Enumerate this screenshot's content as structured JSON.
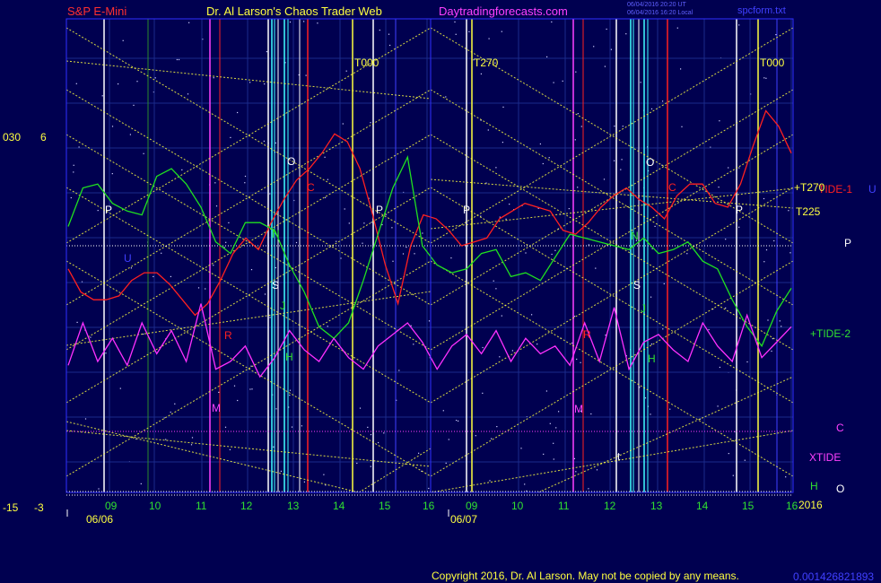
{
  "header": {
    "instrument": "S&P E-Mini",
    "author": "Dr. Al Larson's Chaos Trader Web",
    "site": "Daytradingforecasts.com",
    "stamp1": "06/04/2016 20:20 UT",
    "stamp2": "06/04/2016 16:20 Local",
    "file": "spcform.txt"
  },
  "left_axis": {
    "top": [
      "030",
      "6"
    ],
    "bottom": [
      "-15",
      "-3"
    ]
  },
  "dates": [
    "06/06",
    "06/07"
  ],
  "hour_labels": [
    "09",
    "10",
    "11",
    "12",
    "13",
    "14",
    "15",
    "16",
    "09",
    "10",
    "11",
    "12",
    "13",
    "14",
    "15",
    "16"
  ],
  "year": "2016",
  "marker_labels": {
    "t000a": "T000",
    "t270": "T270",
    "t000b": "T000",
    "plusT270": "+T270",
    "t225": "T225",
    "tide1": "TIDE-1",
    "tide2": "+TIDE-2",
    "xtide": "XTIDE",
    "u": "U",
    "p": "P",
    "c": "C",
    "h": "H",
    "o": "O"
  },
  "letters": [
    {
      "t": "P"
    },
    {
      "t": "U"
    },
    {
      "t": "R"
    },
    {
      "t": "M"
    },
    {
      "t": "N"
    },
    {
      "t": "S"
    },
    {
      "t": "J"
    },
    {
      "t": "H"
    },
    {
      "t": "O"
    },
    {
      "t": "C"
    },
    {
      "t": "P"
    },
    {
      "t": "P"
    },
    {
      "t": "O"
    },
    {
      "t": "C"
    },
    {
      "t": "N"
    },
    {
      "t": "S"
    },
    {
      "t": "J"
    },
    {
      "t": "H"
    },
    {
      "t": "R"
    },
    {
      "t": "M"
    },
    {
      "t": "P"
    },
    {
      "t": "t"
    }
  ],
  "footer": {
    "copyright": "Copyright 2016, Dr. Al Larson. May not be copied by any means.",
    "counter": "0.001426821893"
  },
  "colors": {
    "bg": "#000050",
    "plot_border": "#3030ff",
    "grid": "#1a2a8a",
    "tide1": "#ff2020",
    "tide2": "#20e020",
    "xtide": "#ff30ff",
    "yellow": "#ffff40",
    "white": "#ffffff",
    "cyan": "#40ffff",
    "magenta": "#ff40ff",
    "red_line": "#ff2020",
    "blue_label": "#4040ff",
    "green_label": "#30e030",
    "dotted": "#ffffc0"
  },
  "chart_data": {
    "type": "line",
    "series": [
      {
        "name": "TIDE-1",
        "color": "red",
        "values": [
          -0.6,
          -1.2,
          -1.4,
          -1.4,
          -1.3,
          -0.9,
          -0.7,
          -0.7,
          -1.0,
          -1.4,
          -1.8,
          -1.5,
          -0.9,
          -0.2,
          0.2,
          -0.1,
          0.6,
          1.2,
          1.7,
          2.0,
          2.4,
          2.9,
          2.7,
          2.0,
          0.8,
          -0.5,
          -1.5,
          0.0,
          0.8,
          0.7,
          0.4,
          0.0,
          0.1,
          0.2,
          0.7,
          0.9,
          1.1,
          1.0,
          0.9,
          0.4,
          0.3,
          0.6,
          1.0,
          1.3,
          1.5,
          1.2,
          1.0,
          0.7,
          1.3,
          1.6,
          1.6,
          1.1,
          1.0,
          1.6,
          2.6,
          3.5,
          3.1,
          2.4
        ]
      },
      {
        "name": "TIDE-2",
        "color": "green",
        "values": [
          0.5,
          1.5,
          1.6,
          1.1,
          0.9,
          0.8,
          1.8,
          2.0,
          1.6,
          1.0,
          0.1,
          -0.2,
          0.6,
          0.6,
          0.4,
          -0.5,
          -1.2,
          -2.1,
          -2.4,
          -2.0,
          -0.9,
          0.3,
          1.5,
          2.3,
          0.0,
          -0.5,
          -0.7,
          -0.6,
          -0.2,
          -0.1,
          -0.8,
          -0.7,
          -0.9,
          -0.3,
          0.3,
          0.2,
          0.1,
          0.0,
          -0.1,
          0.2,
          -0.2,
          -0.1,
          0.1,
          -0.4,
          -0.6,
          -1.4,
          -2.1,
          -2.6,
          -1.7,
          -1.1
        ]
      },
      {
        "name": "XTIDE",
        "color": "magenta",
        "values": [
          -3.1,
          -2.0,
          -3.0,
          -2.4,
          -3.1,
          -2.0,
          -2.8,
          -2.2,
          -3.0,
          -1.5,
          -3.2,
          -3.0,
          -2.6,
          -3.4,
          -2.9,
          -2.2,
          -2.7,
          -3.0,
          -2.4,
          -2.9,
          -3.2,
          -2.6,
          -2.3,
          -2.0,
          -2.5,
          -3.2,
          -2.6,
          -2.3,
          -2.8,
          -2.2,
          -3.0,
          -2.4,
          -2.8,
          -2.6,
          -3.1,
          -2.0,
          -3.0,
          -1.6,
          -3.2,
          -2.5,
          -2.3,
          -2.7,
          -3.0,
          -2.0,
          -2.6,
          -3.0,
          -1.8,
          -2.9,
          -2.5,
          -2.1
        ]
      }
    ]
  }
}
